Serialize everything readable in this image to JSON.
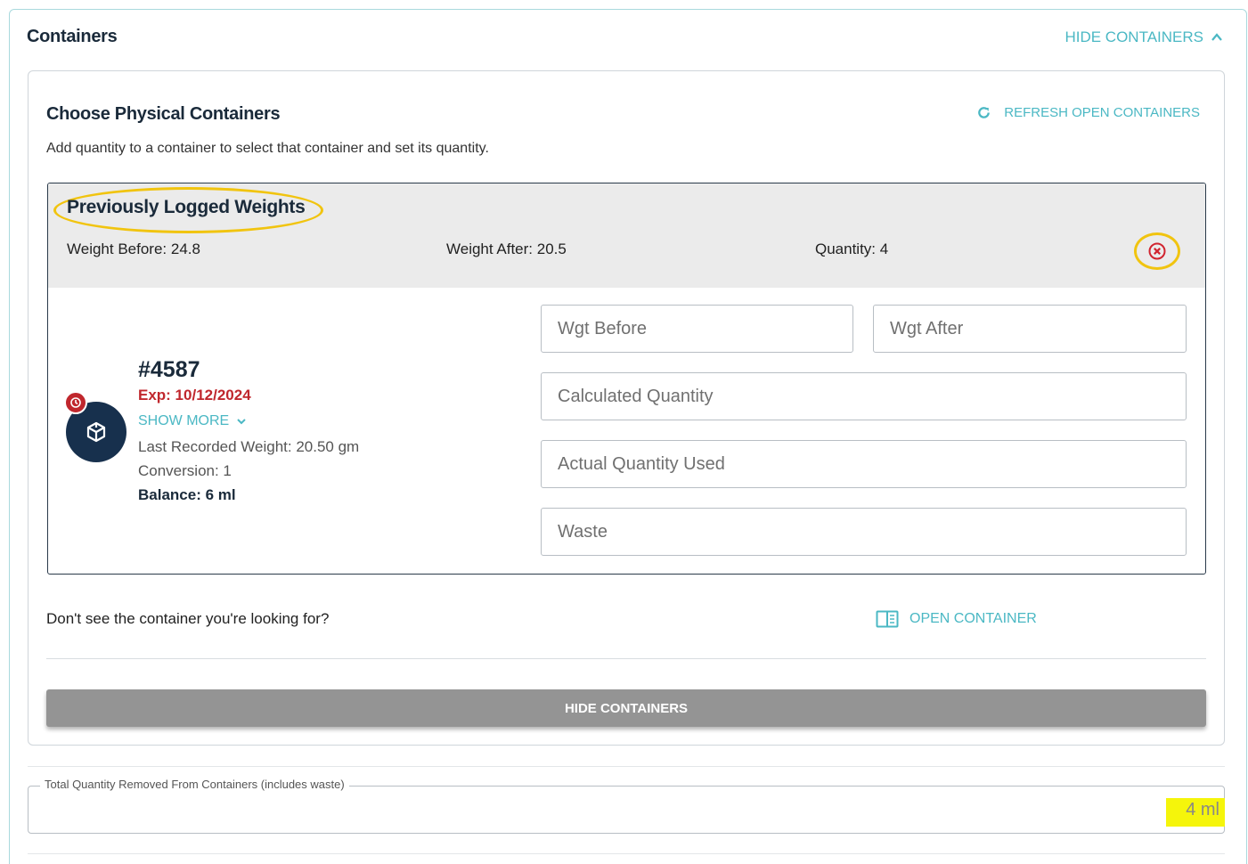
{
  "header": {
    "title": "Containers",
    "hide_link": "HIDE CONTAINERS"
  },
  "choose": {
    "title": "Choose Physical Containers",
    "refresh_label": "REFRESH OPEN CONTAINERS",
    "description": "Add quantity to a container to select that container and set its quantity."
  },
  "logged": {
    "title": "Previously Logged Weights",
    "weight_before": "Weight Before: 24.8",
    "weight_after": "Weight After: 20.5",
    "quantity": "Quantity: 4"
  },
  "item": {
    "id": "#4587",
    "expiry": "Exp: 10/12/2024",
    "show_more": "SHOW MORE",
    "last_weight": "Last Recorded Weight: 20.50 gm",
    "conversion": "Conversion: 1",
    "balance": "Balance: 6 ml"
  },
  "fields": {
    "wgt_before": {
      "placeholder": "Wgt Before",
      "value": ""
    },
    "wgt_after": {
      "placeholder": "Wgt After",
      "value": ""
    },
    "calculated_quantity": {
      "placeholder": "Calculated Quantity",
      "value": ""
    },
    "actual_quantity": {
      "placeholder": "Actual Quantity Used",
      "value": ""
    },
    "waste": {
      "placeholder": "Waste",
      "value": ""
    }
  },
  "footer": {
    "dont_see": "Don't see the container you're looking for?",
    "open_container": "OPEN CONTAINER",
    "hide_button": "HIDE CONTAINERS"
  },
  "total": {
    "label": "Total Quantity Removed From Containers (includes waste)",
    "value": "4  ml"
  },
  "colors": {
    "accent": "#4bb8c4",
    "expiry": "#c0272d",
    "highlight": "#f1c40f",
    "avatar": "#17304d",
    "button": "#949494"
  },
  "icons": {
    "chevron_up": "chevron-up-icon",
    "refresh": "refresh-icon",
    "remove": "close-circle-icon",
    "container": "box-icon",
    "alert": "clock-alert-icon",
    "chevron_down": "chevron-down-icon",
    "open_container": "book-open-icon"
  }
}
